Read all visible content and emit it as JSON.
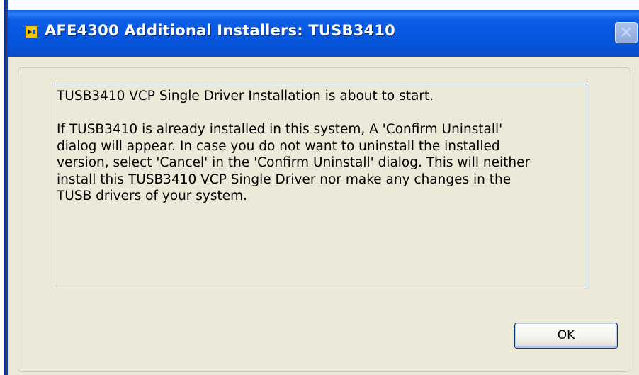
{
  "window": {
    "title": "AFE4300 Additional Installers: TUSB3410",
    "icon": "labview-app-icon",
    "close_label": "✕"
  },
  "message": {
    "line1": "TUSB3410 VCP Single Driver Installation is about to start.",
    "paragraph2_lines": [
      "If TUSB3410 is already installed in this system, A 'Confirm Uninstall'",
      "dialog will appear. In case you do not want to uninstall the installed",
      "version, select 'Cancel' in the 'Confirm Uninstall' dialog. This will neither",
      "install this TUSB3410 VCP Single Driver nor make any changes in the",
      "TUSB drivers of your system."
    ]
  },
  "buttons": {
    "ok_label": "OK"
  },
  "colors": {
    "titlebar": "#0658e0",
    "dialog_bg": "#ece9d8",
    "textbox_border": "#7f9db9",
    "button_border": "#003c74"
  }
}
